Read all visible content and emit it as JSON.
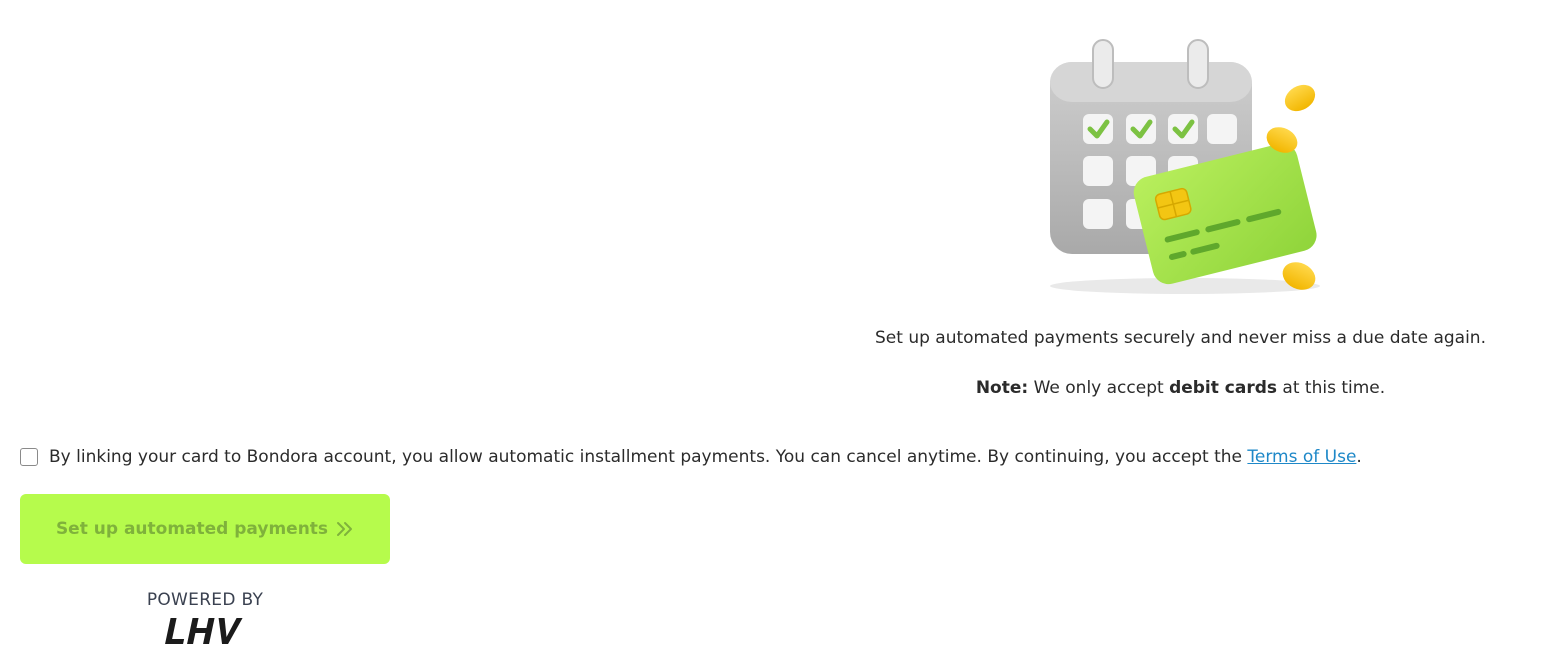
{
  "info": {
    "tagline": "Set up automated payments securely and never miss a due date again.",
    "note_label": "Note:",
    "note_pre": " We only accept ",
    "note_emphasis": "debit cards",
    "note_post": " at this time."
  },
  "consent": {
    "text": "By linking your card to Bondora account, you allow automatic installment payments. You can cancel anytime. By continuing, you accept the ",
    "link_label": "Terms of Use",
    "suffix": ".",
    "checked": false
  },
  "cta": {
    "label": "Set up automated payments",
    "icon": "double-chevron-right-icon"
  },
  "footer": {
    "powered_by": "POWERED BY",
    "logo_text": "LHV"
  },
  "colors": {
    "accent": "#b6fb4c",
    "cta_text": "#7fb23b",
    "link": "#1e88c8"
  }
}
